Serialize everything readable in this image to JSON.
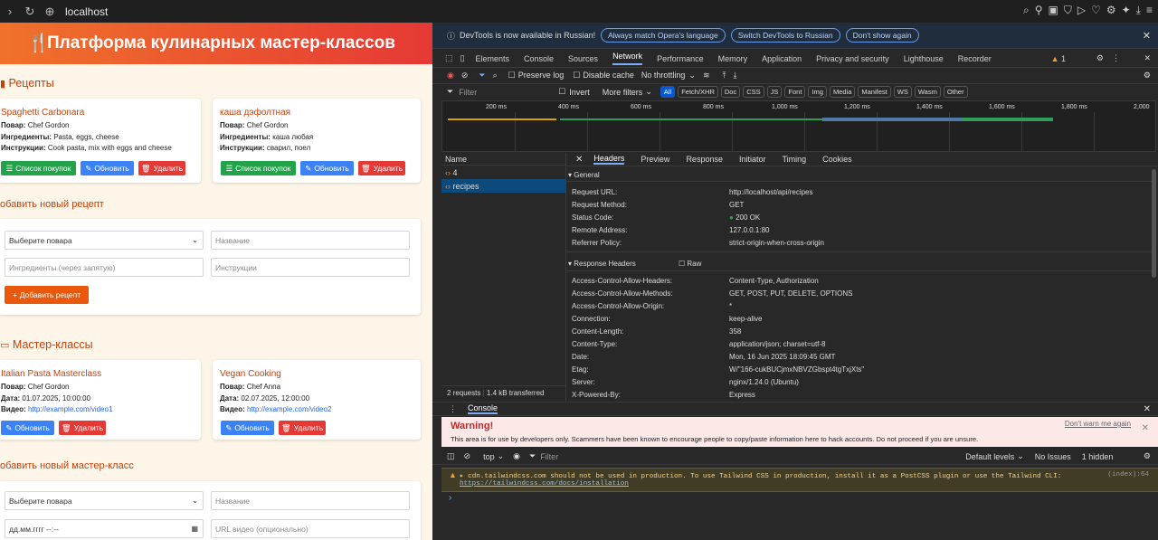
{
  "browser": {
    "url": "localhost"
  },
  "page": {
    "title": "Платформа кулинарных мастер-классов",
    "recipes": {
      "heading": "Рецепты",
      "cards": [
        {
          "name": "Spaghetti Carbonara",
          "cook_label": "Повар:",
          "cook": "Chef Gordon",
          "ing_label": "Ингредиенты:",
          "ingredients": "Pasta, eggs, cheese",
          "ins_label": "Инструкции:",
          "instructions": "Cook pasta, mix with eggs and cheese"
        },
        {
          "name": "каша дэфолтная",
          "cook_label": "Повар:",
          "cook": "Chef Gordon",
          "ing_label": "Ингредиенты:",
          "ingredients": "каша любая",
          "ins_label": "Инструкции:",
          "instructions": "сварил, поел"
        }
      ],
      "shop_label": "Список покупок",
      "update_label": "Обновить",
      "delete_label": "Удалить"
    },
    "new_recipe": {
      "heading": "обавить новый рецепт",
      "chef_select": "Выберите повара",
      "name_placeholder": "Название",
      "ingredients_placeholder": "Ингредиенты (через запятую)",
      "instructions_placeholder": "Инструкции",
      "add_label": "Добавить рецепт"
    },
    "classes": {
      "heading": "Мастер-классы",
      "cards": [
        {
          "name": "Italian Pasta Masterclass",
          "cook_label": "Повар:",
          "cook": "Chef Gordon",
          "date_label": "Дата:",
          "date": "01.07.2025, 10:00:00",
          "video_label": "Видео:",
          "video": "http://example.com/video1"
        },
        {
          "name": "Vegan Cooking",
          "cook_label": "Повар:",
          "cook": "Chef Anna",
          "date_label": "Дата:",
          "date": "02.07.2025, 12:00:00",
          "video_label": "Видео:",
          "video": "http://example.com/video2"
        }
      ],
      "update_label": "Обновить",
      "delete_label": "Удалить"
    },
    "new_class": {
      "heading": "обавить новый мастер-класс",
      "chef_select": "Выберите повара",
      "name_placeholder": "Название",
      "date_placeholder": "дд.мм.гггг --:--",
      "video_placeholder": "URL видео (опционально)"
    }
  },
  "devtools": {
    "notice": "DevTools is now available in Russian!",
    "btn_match": "Always match Opera's language",
    "btn_switch": "Switch DevTools to Russian",
    "btn_dont": "Don't show again",
    "tabs": [
      "Elements",
      "Console",
      "Sources",
      "Network",
      "Performance",
      "Memory",
      "Application",
      "Privacy and security",
      "Lighthouse",
      "Recorder"
    ],
    "warn_count": "1",
    "preserve_log": "Preserve log",
    "disable_cache": "Disable cache",
    "throttling": "No throttling",
    "filter_placeholder": "Filter",
    "invert": "Invert",
    "more_filters": "More filters",
    "chips": [
      "All",
      "Fetch/XHR",
      "Doc",
      "CSS",
      "JS",
      "Font",
      "Img",
      "Media",
      "Manifest",
      "WS",
      "Wasm",
      "Other"
    ],
    "timeline_ticks": [
      "200 ms",
      "400 ms",
      "600 ms",
      "800 ms",
      "1,000 ms",
      "1,200 ms",
      "1,400 ms",
      "1,600 ms",
      "1,800 ms",
      "2,000"
    ],
    "name_header": "Name",
    "requests": [
      "4",
      "recipes"
    ],
    "summary_requests": "2 requests",
    "summary_transferred": "1.4 kB transferred",
    "detail_tabs": [
      "Headers",
      "Preview",
      "Response",
      "Initiator",
      "Timing",
      "Cookies"
    ],
    "general_title": "General",
    "general": [
      {
        "k": "Request URL:",
        "v": "http://localhost/api/recipes"
      },
      {
        "k": "Request Method:",
        "v": "GET"
      },
      {
        "k": "Status Code:",
        "v": "200 OK"
      },
      {
        "k": "Remote Address:",
        "v": "127.0.0.1:80"
      },
      {
        "k": "Referrer Policy:",
        "v": "strict-origin-when-cross-origin"
      }
    ],
    "response_title": "Response Headers",
    "raw_label": "Raw",
    "response": [
      {
        "k": "Access-Control-Allow-Headers:",
        "v": "Content-Type, Authorization"
      },
      {
        "k": "Access-Control-Allow-Methods:",
        "v": "GET, POST, PUT, DELETE, OPTIONS"
      },
      {
        "k": "Access-Control-Allow-Origin:",
        "v": "*"
      },
      {
        "k": "Connection:",
        "v": "keep-alive"
      },
      {
        "k": "Content-Length:",
        "v": "358"
      },
      {
        "k": "Content-Type:",
        "v": "application/json; charset=utf-8"
      },
      {
        "k": "Date:",
        "v": "Mon, 16 Jun 2025 18:09:45 GMT"
      },
      {
        "k": "Etag:",
        "v": "W/\"166-cukBUCjmxNBVZGbspt4tgTxjXts\""
      },
      {
        "k": "Server:",
        "v": "nginx/1.24.0 (Ubuntu)"
      },
      {
        "k": "X-Powered-By:",
        "v": "Express"
      }
    ],
    "console_tab": "Console",
    "warning_title": "Warning!",
    "warning_text": "This area is for use by developers only. Scammers have been known to encourage people to copy/paste information here to hack accounts. Do not proceed if you are unsure.",
    "dont_warn": "Don't warn me again",
    "context": "top",
    "console_filter": "Filter",
    "levels": "Default levels",
    "no_issues": "No Issues",
    "hidden": "1 hidden",
    "log_text": "cdn.tailwindcss.com should not be used in production. To use Tailwind CSS in production, install it as a PostCSS plugin or use the Tailwind CLI:",
    "log_link": "https://tailwindcss.com/docs/installation",
    "log_source": "(index):64"
  }
}
